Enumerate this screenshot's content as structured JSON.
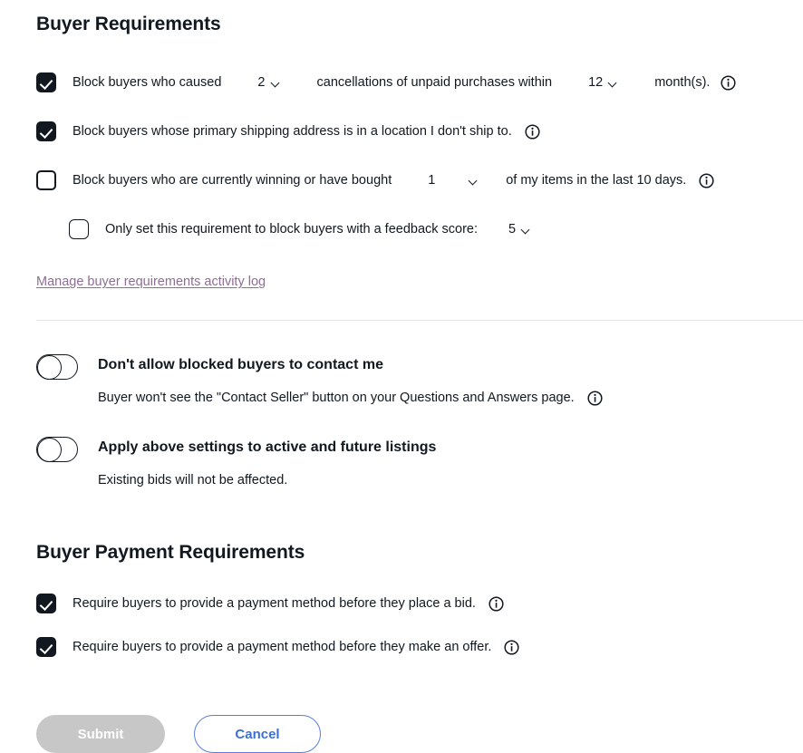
{
  "sections": {
    "buyer_requirements": {
      "title": "Buyer Requirements",
      "rows": [
        {
          "id": "unpaid-cancellations",
          "checked": true,
          "label_before": "Block buyers who caused",
          "select_count": {
            "value": "2",
            "name": "cancellation-count-select"
          },
          "label_middle": "cancellations of unpaid purchases within",
          "select_period": {
            "value": "12",
            "name": "cancellation-period-select"
          },
          "label_after": "month(s).",
          "info": "info-icon"
        },
        {
          "id": "shipping-location",
          "checked": true,
          "label": "Block buyers whose primary shipping address is in a location I don't ship to.",
          "info": "info-icon"
        },
        {
          "id": "bidding-limit",
          "checked": false,
          "label_before": "Block buyers who are currently winning or have bought",
          "select_items": {
            "value": "1",
            "name": "item-count-select"
          },
          "label_after": "of my items in the last 10 days.",
          "info": "info-icon"
        },
        {
          "id": "feedback-score",
          "checked": false,
          "nested": true,
          "label": "Only set this requirement to block buyers with a feedback score:",
          "select_score": {
            "value": "5",
            "name": "feedback-score-select"
          }
        }
      ],
      "activity_log_link": "Manage buyer requirements activity log"
    },
    "toggles": [
      {
        "id": "block-contact",
        "on": false,
        "title": "Don't allow blocked buyers to contact me",
        "subtitle": "Buyer won't see the \"Contact Seller\" button on your Questions and Answers page.",
        "info": "info-icon"
      },
      {
        "id": "apply-active-future",
        "on": false,
        "title": "Apply above settings to active and future listings",
        "subtitle": "Existing bids will not be affected.",
        "info": null
      }
    ],
    "buyer_payment_requirements": {
      "title": "Buyer Payment Requirements",
      "rows": [
        {
          "id": "payment-before-bid",
          "checked": true,
          "label": "Require buyers to provide a payment method before they place a bid.",
          "info": "info-icon"
        },
        {
          "id": "payment-before-offer",
          "checked": true,
          "label": "Require buyers to provide a payment method before they make an offer.",
          "info": "info-icon"
        }
      ]
    }
  },
  "actions": {
    "submit_label": "Submit",
    "cancel_label": "Cancel"
  },
  "colors": {
    "text": "#111820",
    "link": "#8e6e94",
    "divider": "#e5e5e5",
    "submit_bg": "#c7c7c7",
    "cancel_border": "#5a7fd4",
    "cancel_text": "#3f6fd6",
    "checkbox_fill": "#111820"
  }
}
